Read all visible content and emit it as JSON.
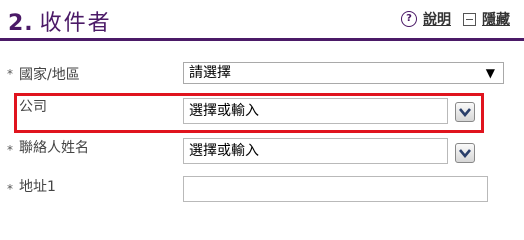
{
  "section": {
    "number": "2.",
    "title": "收件者"
  },
  "header_links": {
    "help_label": "說明",
    "hide_label": "隱藏",
    "help_icon": "?"
  },
  "fields": {
    "country": {
      "label": "國家/地區",
      "value": "請選擇",
      "required_mark": "*"
    },
    "company": {
      "label": "公司",
      "value": "選擇或輸入"
    },
    "contact": {
      "label": "聯絡人姓名",
      "value": "選擇或輸入",
      "required_mark": "*"
    },
    "address1": {
      "label": "地址1",
      "value": "",
      "required_mark": "*"
    }
  },
  "colors": {
    "accent": "#4b1a67",
    "highlight": "#e0141e"
  }
}
